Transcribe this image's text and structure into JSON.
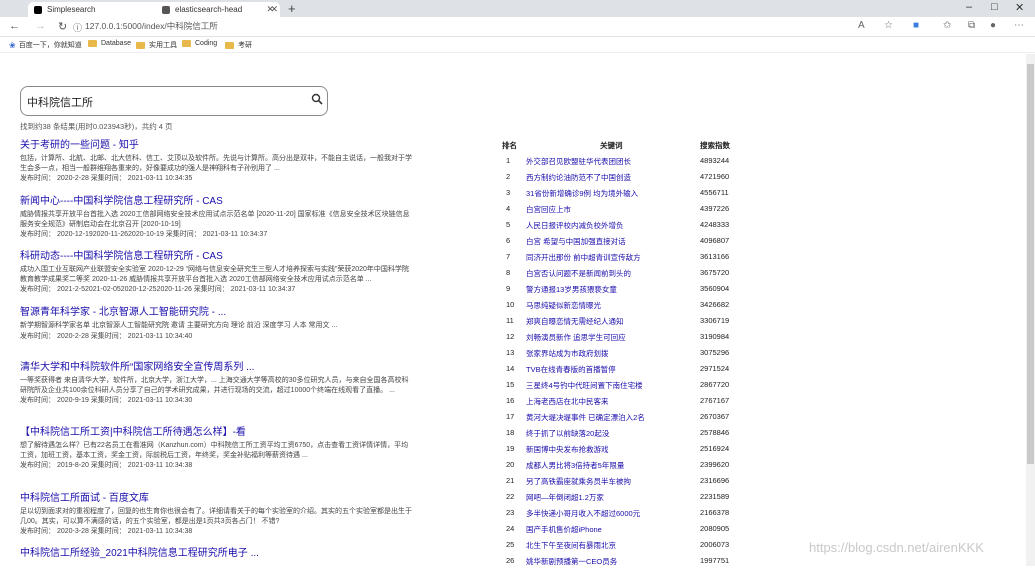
{
  "browser": {
    "tabs": [
      {
        "label": "Simplesearch",
        "favicon_color": "#000000"
      },
      {
        "label": "elasticsearch-head",
        "favicon_color": "#555555"
      }
    ],
    "url": "127.0.0.1:5000/index/中科院信工所",
    "bookmarks": [
      "百度一下，你就知道",
      "Database",
      "实用工具",
      "Coding",
      "考研"
    ]
  },
  "search": {
    "value": "中科院信工所",
    "stats": "找到约38 条结果(用时0.023943秒)，共约 4 页"
  },
  "results": [
    {
      "title": "关于考研的一些问题 - 知乎",
      "snippet": "包括，计算所、北航、北邮、北大信科、信工、艾顶以及软件所。先说与计算所。高分出是双非，不能自主说话，一般我对于学生会多一点，相当一般群维翔各重来的，好像要成功的强人是神翔科有子孙别用了 ...",
      "meta": "发布时间： 2020-2-28  采集时间： 2021-03-11 10:34:35"
    },
    {
      "title": "新闻中心----中国科学院信息工程研究所 - CAS",
      "snippet": "威胁情报共享开放平台首批入选 2020工信部网络安全技术应用试点示范名单 [2020-11-20] 国家标准《信息安全技术区块链信息服务安全规范》研制启动会在北京召开 [2020-10-19]",
      "meta": "发布时间： 2020-12-192020-11-262020-10-19  采集时间： 2021-03-11 10:34:37"
    },
    {
      "title": "科研动态----中国科学院信息工程研究所 - CAS",
      "snippet": "成功入围工业互联网产业联盟安全实验室 2020-12-29 “网络与信息安全研究生三型人才培养探索与实践”荣获2020年中国科学院教育教学成果奖二等奖 2020-11-26 威胁情报共享开放平台首批入选 2020工信部网络安全技术应用试点示范名单 ...",
      "meta": "发布时间： 2021-2-52021-02-052020-12-252020-11-26  采集时间： 2021-03-11 10:34:37"
    },
    {
      "title": "智源青年科学家 - 北京智源人工智能研究院 - ...",
      "snippet": "新学期智源科学家名单 北京智源人工智能研究院 邀请 主要研究方向 理论 前沿 深度学习 人本 常用文 ...",
      "meta": "发布时间： 2020-2-28  采集时间： 2021-03-11 10:34:40"
    },
    {
      "title": "清华大学和中科院软件所“国家网络安全宣传周系列 ...",
      "snippet": "一等奖获得者 来自清华大学，软件所，北京大学，浙江大学，... 上海交通大学等高校的30多位研究人员，与来自全国各高校科研院所及企业共100余位科研人员分享了自己的学术研究成果，并进行现场的交流，超过10000个终端在线观看了直播。 ...",
      "meta": "发布时间： 2020-9-19  采集时间： 2021-03-11 10:34:30"
    },
    {
      "title": "【中科院信工所工资|中科院信工所待遇怎么样】-看",
      "snippet": "想了解待遇怎么样？已有22名员工在看准网（Kanzhun.com）中科院信工所工资平均工资6750，点击查看工资详情详情，平均工资，加班工资，基本工资，奖金工资，际前税后工资，年终奖，奖金补贴福利等薪资待遇 ...",
      "meta": "发布时间： 2019-8-20  采集时间： 2021-03-11 10:34:38"
    },
    {
      "title": "中科院信工所面试 - 百度文库",
      "snippet": "足以切到面求对的重视程度了，回复的也生育你也很会有了。详细请看关于的每个实验室的介绍。其实的五个实验室都是出生于几00。其实，可以算不满感的话，的五个实验室，都是出是1页共3页各占门！ 不错?",
      "meta": "发布时间： 2020-3-28  采集时间： 2021-03-11 10:34:38"
    },
    {
      "title": "中科院信工所经验_2021中科院信息工程研究所电子 ...",
      "snippet": "",
      "meta": ""
    }
  ],
  "hot": {
    "headers": [
      "排名",
      "关键词",
      "搜索指数"
    ],
    "rows": [
      {
        "rank": "1",
        "title": "外交部召见欧盟驻华代表团团长",
        "score": "4893244"
      },
      {
        "rank": "2",
        "title": "西方制约论油防范不了中国创造",
        "score": "4721960"
      },
      {
        "rank": "3",
        "title": "31省份新增确诊9例 均为境外输入",
        "score": "4556711"
      },
      {
        "rank": "4",
        "title": "白宫回应上市",
        "score": "4397226"
      },
      {
        "rank": "5",
        "title": "人民日报评校内减负校外增负",
        "score": "4248333"
      },
      {
        "rank": "6",
        "title": "白宫 希望与中国加强直接对话",
        "score": "4096807"
      },
      {
        "rank": "7",
        "title": "同济开出那份 前中超青训宣传敌方",
        "score": "3613166"
      },
      {
        "rank": "8",
        "title": "白宫否认问题不是新闻前到头的",
        "score": "3675720"
      },
      {
        "rank": "9",
        "title": "警方通报13岁男孩猥亵女童",
        "score": "3560904"
      },
      {
        "rank": "10",
        "title": "马思纯疑似新恋情曝光",
        "score": "3426682"
      },
      {
        "rank": "11",
        "title": "郑爽自曝恋情无需经纪人通知",
        "score": "3306719"
      },
      {
        "rank": "12",
        "title": "刘畅演员新作 追思学生可回应",
        "score": "3190984"
      },
      {
        "rank": "13",
        "title": "张家界站成为市政府划拨",
        "score": "3075296"
      },
      {
        "rank": "14",
        "title": "TVB在线青春版的首播暂停",
        "score": "2971524"
      },
      {
        "rank": "15",
        "title": "三星终4号钓中代旺间置下南住宅楼",
        "score": "2867720"
      },
      {
        "rank": "16",
        "title": "上海老西店在北中民客来",
        "score": "2767167"
      },
      {
        "rank": "17",
        "title": "黄河大堤决堤事件 已确定漂泊入2名",
        "score": "2670367"
      },
      {
        "rank": "18",
        "title": "终于抓了以前缺落20起没",
        "score": "2578846"
      },
      {
        "rank": "19",
        "title": "新国博中央发布抢救游戏",
        "score": "2516924"
      },
      {
        "rank": "20",
        "title": "成都人男比将3倍持者5年限量",
        "score": "2399620"
      },
      {
        "rank": "21",
        "title": "另了高铁霸座就乘务员半车被拘",
        "score": "2316696"
      },
      {
        "rank": "22",
        "title": "网吧—年倒闭超1.2万家",
        "score": "2231589"
      },
      {
        "rank": "23",
        "title": "多半快递小哥月收入不超过6000元",
        "score": "2166378"
      },
      {
        "rank": "24",
        "title": "国产手机售价超iPhone",
        "score": "2080905"
      },
      {
        "rank": "25",
        "title": "北生下午至夜间有暴雨北京",
        "score": "2006073"
      },
      {
        "rank": "26",
        "title": "姚华新剧预播第一CEO员务",
        "score": "1997751"
      }
    ]
  },
  "watermark": "https://blog.csdn.net/airenKKK"
}
